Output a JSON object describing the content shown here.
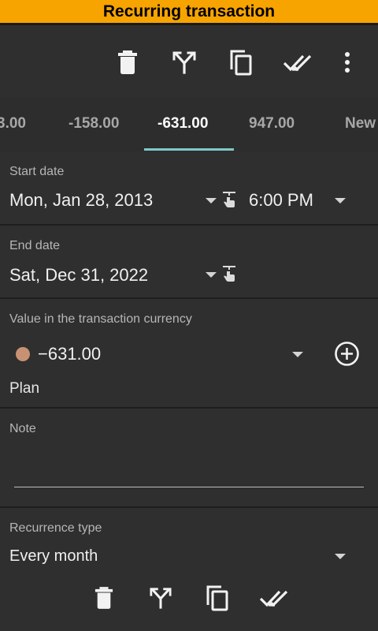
{
  "title": "Recurring transaction",
  "toolbar": {
    "icons": [
      "delete-icon",
      "split-icon",
      "copy-icon",
      "done-all-icon",
      "more-vert-icon"
    ]
  },
  "tabs": [
    {
      "label": "3.00"
    },
    {
      "label": "-158.00"
    },
    {
      "label": "-631.00",
      "active": true
    },
    {
      "label": "947.00"
    },
    {
      "label": "New"
    }
  ],
  "start": {
    "label": "Start date",
    "date": "Mon, Jan 28, 2013",
    "time": "6:00 PM"
  },
  "end": {
    "label": "End date",
    "date": "Sat, Dec 31, 2022"
  },
  "value": {
    "label": "Value in the transaction currency",
    "amount": "−631.00",
    "dot_color": "#c79273",
    "plan": "Plan"
  },
  "note": {
    "label": "Note",
    "value": ""
  },
  "recurrence": {
    "label": "Recurrence type",
    "value": "Every month"
  },
  "bottom_bar": {
    "icons": [
      "delete-icon",
      "split-icon",
      "copy-icon",
      "done-all-icon"
    ]
  },
  "colors": {
    "title_bar": "#f7a400",
    "accent": "#7fc9c9",
    "background": "#2b2b2b"
  }
}
